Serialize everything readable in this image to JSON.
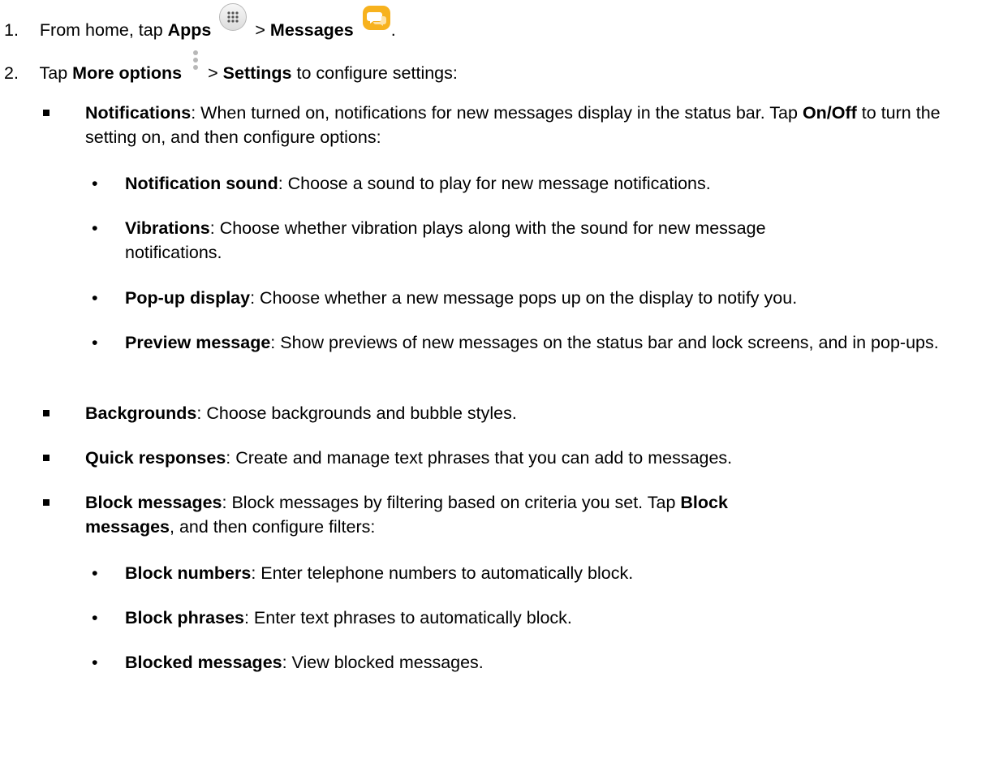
{
  "steps": [
    {
      "number": "1.",
      "text_from": "From home, tap",
      "apps": "Apps",
      "sep": ">",
      "messages": "Messages",
      "end": "."
    },
    {
      "number": "2.",
      "text_tap": "Tap",
      "more_options": "More options",
      "sep": ">",
      "settings": "Settings",
      "rest": "to configure settings:"
    }
  ],
  "notifications": {
    "title": "Notifications",
    "desc": ": When turned on, notifications for new messages display in the status bar. Tap",
    "onoff": "On/Off",
    "desc2": "to turn the setting on, and then configure options:",
    "options": [
      {
        "title": "Notification sound",
        "desc": ": Choose a sound to play for new message notifications."
      },
      {
        "title": "Vibrations",
        "desc": ": Choose whether vibration plays along with the sound for new message notifications."
      },
      {
        "title": "Pop-up display",
        "desc": ": Choose whether a new message pops up on the display to notify you."
      },
      {
        "title": "Preview message",
        "desc": ": Show previews of new messages on the status bar and lock screens, and in pop-ups."
      }
    ]
  },
  "backgrounds": {
    "title": "Backgrounds",
    "desc": ": Choose backgrounds and bubble styles."
  },
  "quick_responses": {
    "title": "Quick responses",
    "desc": ": Create and manage text phrases that you can add to messages."
  },
  "block_messages": {
    "title": "Block messages",
    "desc": ": Block messages by filtering based on criteria you set. Tap",
    "tap_target": "Block messages",
    "desc2": ", and then configure filters:",
    "options": [
      {
        "title": "Block numbers",
        "desc": ": Enter telephone numbers to automatically block."
      },
      {
        "title": "Block phrases",
        "desc": ": Enter text phrases to automatically block."
      },
      {
        "title": "Blocked messages",
        "desc": ": View blocked messages."
      }
    ]
  },
  "bullet_dot": "•",
  "colors": {
    "text": "#000000",
    "messages_icon": "#f7b21e"
  },
  "icons": [
    "apps-grid-icon",
    "messages-bubble-icon",
    "more-options-icon"
  ]
}
